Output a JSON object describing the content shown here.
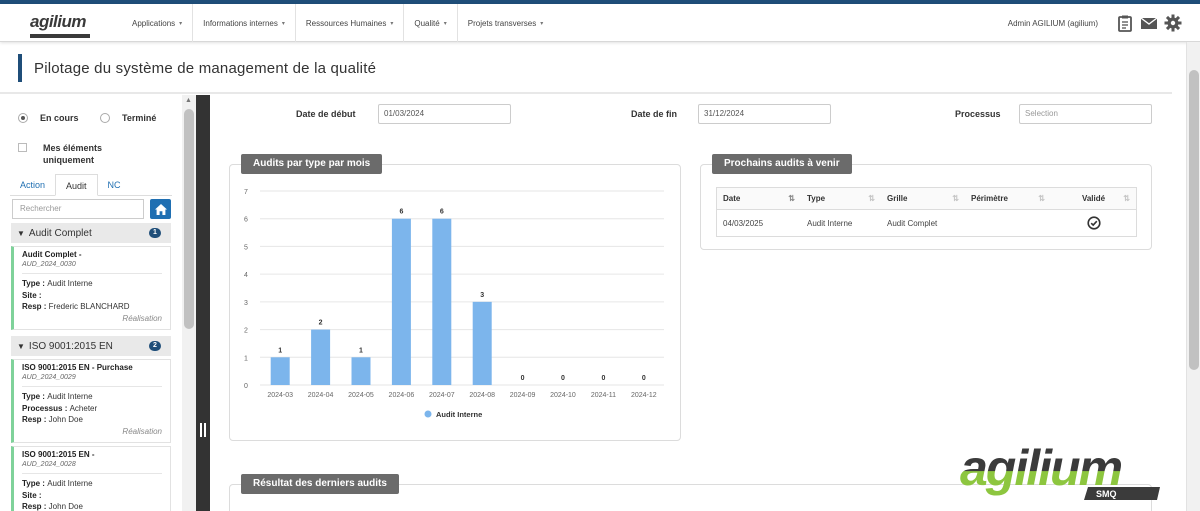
{
  "app": {
    "logo_text": "agilium",
    "big_logo_text": "agilium",
    "big_logo_sub": "SMQ"
  },
  "nav": {
    "menu": [
      {
        "label": "Applications"
      },
      {
        "label": "Informations internes"
      },
      {
        "label": "Ressources Humaines"
      },
      {
        "label": "Qualité"
      },
      {
        "label": "Projets transverses"
      }
    ],
    "user": "Admin AGILIUM (agilium)",
    "icons": [
      "clipboard-icon",
      "mail-icon",
      "gear-icon"
    ]
  },
  "page": {
    "title": "Pilotage du système de management de la qualité"
  },
  "sidebar": {
    "radio_en_cours": "En cours",
    "radio_termine": "Terminé",
    "checkbox_mes_elements": "Mes éléments uniquement",
    "tabs": [
      {
        "label": "Action",
        "active": false
      },
      {
        "label": "Audit",
        "active": true
      },
      {
        "label": "NC",
        "active": false
      }
    ],
    "search_placeholder": "Rechercher",
    "groups": [
      {
        "name": "Audit Complet",
        "count": "1",
        "cards": [
          {
            "title": "Audit Complet -",
            "id": "AUD_2024_0030",
            "lines": [
              {
                "key": "Type",
                "value": "Audit Interne"
              },
              {
                "key": "Site",
                "value": ""
              },
              {
                "key": "Resp",
                "value": "Frederic BLANCHARD"
              }
            ],
            "status": "Réalisation"
          }
        ]
      },
      {
        "name": "ISO 9001:2015 EN",
        "count": "2",
        "cards": [
          {
            "title": "ISO 9001:2015 EN - Purchase",
            "id": "AUD_2024_0029",
            "lines": [
              {
                "key": "Type",
                "value": "Audit Interne"
              },
              {
                "key": "Processus",
                "value": "Acheter"
              },
              {
                "key": "Resp",
                "value": "John Doe"
              }
            ],
            "status": "Réalisation"
          },
          {
            "title": "ISO 9001:2015 EN -",
            "id": "AUD_2024_0028",
            "lines": [
              {
                "key": "Type",
                "value": "Audit Interne"
              },
              {
                "key": "Site",
                "value": ""
              },
              {
                "key": "Resp",
                "value": "John Doe"
              }
            ],
            "status": ""
          }
        ]
      }
    ]
  },
  "filters": {
    "date_debut_label": "Date de début",
    "date_debut_value": "01/03/2024",
    "date_fin_label": "Date de fin",
    "date_fin_value": "31/12/2024",
    "processus_label": "Processus",
    "processus_placeholder": "Selection"
  },
  "panels": {
    "chart_title": "Audits par type par mois",
    "upcoming_title": "Prochains audits à venir",
    "results_title": "Résultat des derniers audits"
  },
  "upcoming_table": {
    "columns": [
      "Date",
      "Type",
      "Grille",
      "Périmètre",
      "Validé"
    ],
    "rows": [
      {
        "date": "04/03/2025",
        "type": "Audit Interne",
        "grille": "Audit Complet",
        "perimetre": "",
        "valide": "check-circle-icon"
      }
    ]
  },
  "chart_data": {
    "type": "bar",
    "title": "Audits par type par mois",
    "categories": [
      "2024-03",
      "2024-04",
      "2024-05",
      "2024-06",
      "2024-07",
      "2024-08",
      "2024-09",
      "2024-10",
      "2024-11",
      "2024-12"
    ],
    "series": [
      {
        "name": "Audit Interne",
        "values": [
          1,
          2,
          1,
          6,
          6,
          3,
          0,
          0,
          0,
          0
        ],
        "color": "#7cb5ec"
      }
    ],
    "ylim": [
      0,
      7
    ],
    "yticks": [
      0,
      1,
      2,
      3,
      4,
      5,
      6,
      7
    ],
    "grid": true,
    "legend": "bottom-center",
    "data_labels": true
  }
}
